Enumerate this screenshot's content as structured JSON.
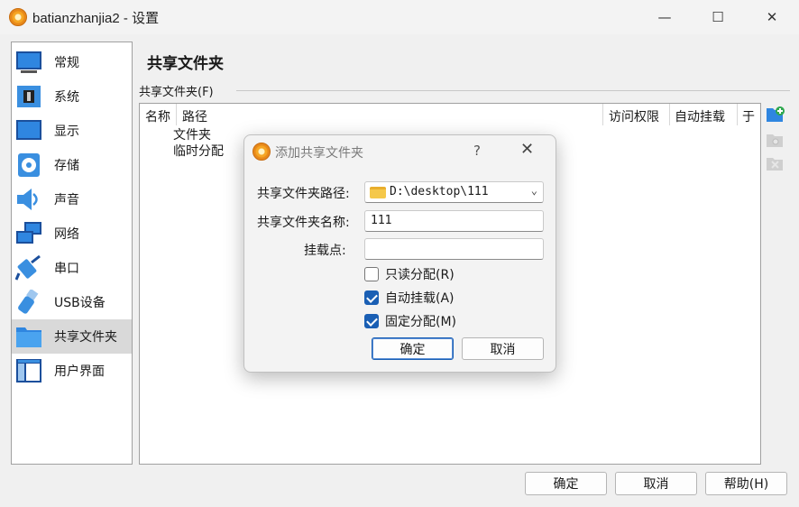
{
  "window": {
    "title": "batianzhanjia2 - 设置",
    "minimize": "—",
    "maximize": "☐",
    "close": "✕"
  },
  "sidebar": {
    "items": [
      {
        "label": "常规",
        "icon": "monitor-icon"
      },
      {
        "label": "系统",
        "icon": "chip-icon"
      },
      {
        "label": "显示",
        "icon": "display-icon"
      },
      {
        "label": "存储",
        "icon": "storage-icon"
      },
      {
        "label": "声音",
        "icon": "speaker-icon"
      },
      {
        "label": "网络",
        "icon": "network-icon"
      },
      {
        "label": "串口",
        "icon": "serial-port-icon"
      },
      {
        "label": "USB设备",
        "icon": "usb-icon"
      },
      {
        "label": "共享文件夹",
        "icon": "shared-folder-icon",
        "selected": true
      },
      {
        "label": "用户界面",
        "icon": "user-interface-icon"
      }
    ]
  },
  "main": {
    "title": "共享文件夹",
    "group_label": "共享文件夹(F)",
    "columns": [
      "名称",
      "路径",
      "访问权限",
      "自动挂载",
      "于"
    ],
    "tree": [
      "文件夹",
      "临时分配"
    ]
  },
  "footer": {
    "ok": "确定",
    "cancel": "取消",
    "help": "帮助(H)"
  },
  "dialog": {
    "title": "添加共享文件夹",
    "help": "?",
    "close": "✕",
    "path_label": "共享文件夹路径:",
    "path_value": "D:\\desktop\\111",
    "name_label": "共享文件夹名称:",
    "name_value": "111",
    "mount_label": "挂载点:",
    "mount_value": "",
    "readonly_label": "只读分配(R)",
    "readonly_checked": false,
    "automount_label": "自动挂载(A)",
    "automount_checked": true,
    "permanent_label": "固定分配(M)",
    "permanent_checked": true,
    "ok": "确定",
    "cancel": "取消"
  },
  "colors": {
    "accent": "#1a5fb4",
    "selected_bg": "#d9d9d9"
  }
}
